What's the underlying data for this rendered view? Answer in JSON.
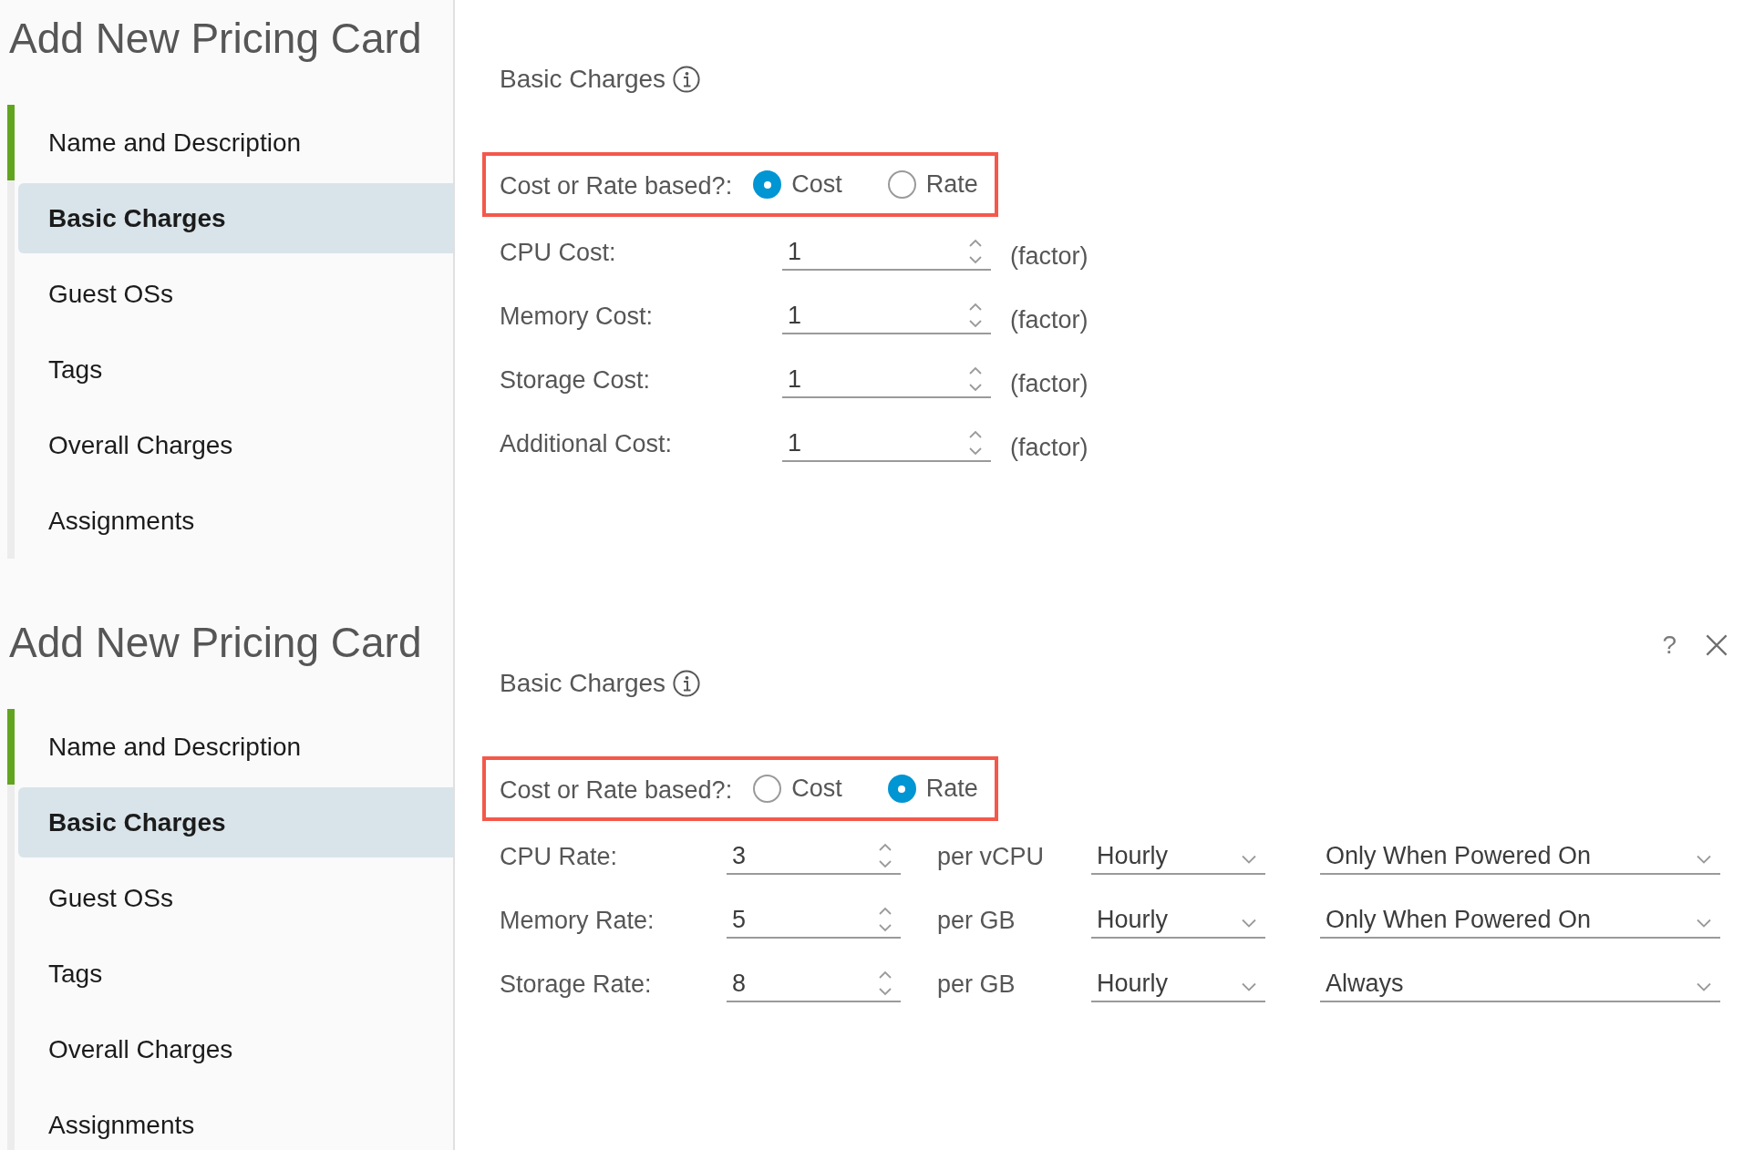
{
  "panels": [
    {
      "sidebar": {
        "title": "Add New Pricing Card",
        "steps": [
          {
            "label": "Name and Description",
            "completed": true,
            "selected": false
          },
          {
            "label": "Basic Charges",
            "completed": false,
            "selected": true
          },
          {
            "label": "Guest OSs",
            "completed": false,
            "selected": false
          },
          {
            "label": "Tags",
            "completed": false,
            "selected": false
          },
          {
            "label": "Overall Charges",
            "completed": false,
            "selected": false
          },
          {
            "label": "Assignments",
            "completed": false,
            "selected": false
          }
        ]
      },
      "section": {
        "title": "Basic Charges"
      },
      "pricing_basis": {
        "label": "Cost or Rate based?:",
        "options": [
          {
            "label": "Cost",
            "selected": true
          },
          {
            "label": "Rate",
            "selected": false
          }
        ]
      },
      "fields": [
        {
          "kind": "factor",
          "label": "CPU Cost:",
          "value": "1",
          "unit": "(factor)"
        },
        {
          "kind": "factor",
          "label": "Memory Cost:",
          "value": "1",
          "unit": "(factor)"
        },
        {
          "kind": "factor",
          "label": "Storage Cost:",
          "value": "1",
          "unit": "(factor)"
        },
        {
          "kind": "factor",
          "label": "Additional Cost:",
          "value": "1",
          "unit": "(factor)"
        }
      ]
    },
    {
      "sidebar": {
        "title": "Add New Pricing Card",
        "steps": [
          {
            "label": "Name and Description",
            "completed": true,
            "selected": false
          },
          {
            "label": "Basic Charges",
            "completed": false,
            "selected": true
          },
          {
            "label": "Guest OSs",
            "completed": false,
            "selected": false
          },
          {
            "label": "Tags",
            "completed": false,
            "selected": false
          },
          {
            "label": "Overall Charges",
            "completed": false,
            "selected": false
          },
          {
            "label": "Assignments",
            "completed": false,
            "selected": false
          }
        ]
      },
      "window_controls": [
        {
          "kind": "help",
          "label": "?"
        },
        {
          "kind": "close"
        }
      ],
      "section": {
        "title": "Basic Charges"
      },
      "pricing_basis": {
        "label": "Cost or Rate based?:",
        "options": [
          {
            "label": "Cost",
            "selected": false
          },
          {
            "label": "Rate",
            "selected": true
          }
        ]
      },
      "fields": [
        {
          "kind": "rate",
          "label": "CPU Rate:",
          "value": "3",
          "unit": "per vCPU",
          "period": "Hourly",
          "condition": "Only When Powered On"
        },
        {
          "kind": "rate",
          "label": "Memory Rate:",
          "value": "5",
          "unit": "per GB",
          "period": "Hourly",
          "condition": "Only When Powered On"
        },
        {
          "kind": "rate",
          "label": "Storage Rate:",
          "value": "8",
          "unit": "per GB",
          "period": "Hourly",
          "condition": "Always"
        }
      ]
    }
  ]
}
